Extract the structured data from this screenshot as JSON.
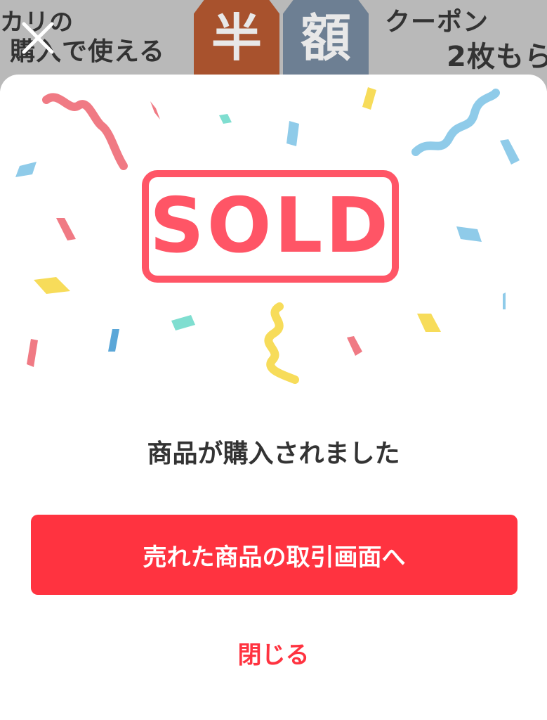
{
  "banner": {
    "line_left_1": "カリの",
    "line_left_2": "購入で使える",
    "badge_1": "半",
    "badge_2": "額",
    "line_right_1": "クーポン",
    "line_right_2": "2枚もら"
  },
  "close_icon": "close-icon",
  "modal": {
    "sold_label": "SOLD",
    "message": "商品が購入されました",
    "primary_button": "売れた商品の取引画面へ",
    "close_link": "閉じる"
  },
  "colors": {
    "accent": "#ff3340",
    "sold_red": "#ff5566",
    "text": "#333333",
    "confetti_blue": "#8fcbe9",
    "confetti_yellow": "#f7dc5a",
    "confetti_teal": "#7fded0",
    "confetti_pink": "#f07a84"
  }
}
